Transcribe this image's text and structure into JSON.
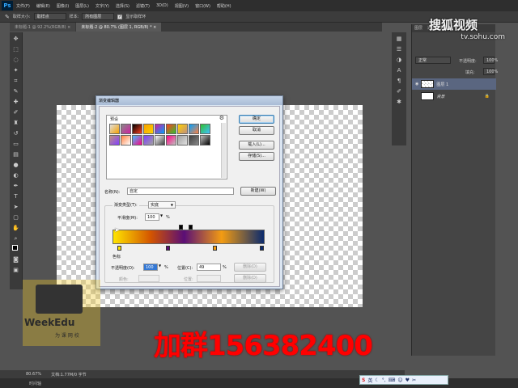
{
  "app": {
    "logo": "Ps"
  },
  "menu": [
    "文件(F)",
    "编辑(E)",
    "图像(I)",
    "图层(L)",
    "文字(Y)",
    "选择(S)",
    "滤镜(T)",
    "3D(D)",
    "视图(V)",
    "窗口(W)",
    "帮助(H)"
  ],
  "options_bar": {
    "sample_size_label": "取样大小:",
    "sample_size_value": "取样点",
    "sample_label": "样本:",
    "sample_value": "所有图层",
    "show_ring_label": "显示取样环"
  },
  "tabs": [
    {
      "label": "未标题-1 @ 92.2%(RGB/8) ×",
      "active": false
    },
    {
      "label": "未标题-2 @ 80.7% (图层 1, RGB/8) * ×",
      "active": true
    }
  ],
  "dialog": {
    "title": "渐变编辑器",
    "presets_label": "预设",
    "ok": "确定",
    "cancel": "取消",
    "load": "载入(L)...",
    "save": "存储(S)...",
    "name_label": "名称(N):",
    "name_value": "自定",
    "new_button": "新建(W)",
    "gradient_type_label": "渐变类型(T):",
    "gradient_type_value": "实底",
    "smoothness_label": "平滑度(M):",
    "smoothness_value": "100",
    "percent": "%",
    "stops_group_label": "色标",
    "opacity_label": "不透明度(O):",
    "opacity_value": "100",
    "location_label": "位置(C):",
    "location_value": "49",
    "location2_label": "位置:",
    "color_label": "颜色:",
    "delete_label": "删除(D)",
    "swatches": [
      "#e0e0e0",
      "#888888",
      "#000000",
      "#f4a000",
      "#d020a0",
      "#ff4020",
      "#ffd000",
      "#00a0ff",
      "#30c030",
      "#c09080",
      "#ff8040",
      "#40c0ff",
      "#8040ff",
      "#ffffff",
      "#ff0080",
      "#a0a0a0",
      "#404040",
      "#c0c0c0"
    ]
  },
  "layers": {
    "tabs": [
      "图层",
      "通道",
      "路径"
    ],
    "blend_mode": "正常",
    "opacity_label": "不透明度:",
    "opacity_value": "100%",
    "fill_label": "填充:",
    "fill_value": "100%",
    "rows": [
      {
        "name": "图层 1"
      },
      {
        "name": "背景"
      }
    ]
  },
  "status": {
    "zoom": "80.67%",
    "doc": "文档:1.77M/0 字节"
  },
  "bottom": {
    "label": "时间轴"
  },
  "overlays": {
    "sohu_line1": "搜狐视频",
    "sohu_line2": "tv.sohu.com",
    "weekedu_brand": "WeekEdu",
    "weekedu_sub": "为 课 网 校",
    "promo_text": "加群156382400"
  }
}
